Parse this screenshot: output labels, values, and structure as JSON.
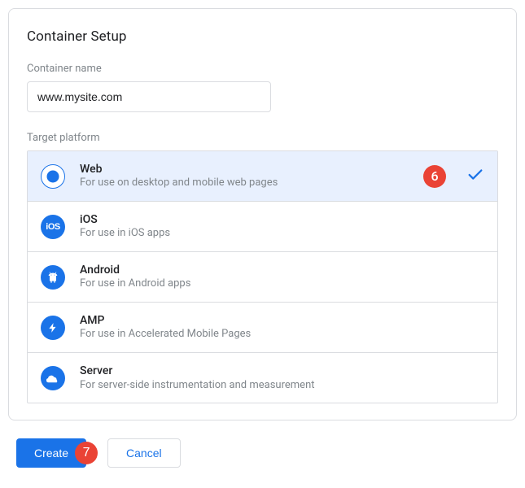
{
  "card": {
    "title": "Container Setup",
    "name_label": "Container name",
    "name_value": "www.mysite.com",
    "platform_label": "Target platform"
  },
  "platforms": [
    {
      "title": "Web",
      "desc": "For use on desktop and mobile web pages",
      "selected": true
    },
    {
      "title": "iOS",
      "desc": "For use in iOS apps",
      "selected": false
    },
    {
      "title": "Android",
      "desc": "For use in Android apps",
      "selected": false
    },
    {
      "title": "AMP",
      "desc": "For use in Accelerated Mobile Pages",
      "selected": false
    },
    {
      "title": "Server",
      "desc": "For server-side instrumentation and measurement",
      "selected": false
    }
  ],
  "annotations": {
    "platform": "6",
    "create": "7"
  },
  "buttons": {
    "create": "Create",
    "cancel": "Cancel"
  }
}
